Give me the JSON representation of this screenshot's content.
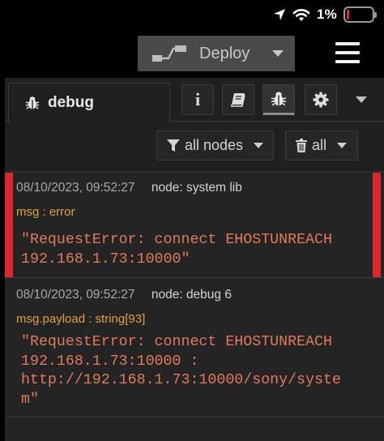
{
  "status": {
    "battery_percent": "1%",
    "battery_level": 0.1,
    "battery_color": "#e52b2b"
  },
  "header": {
    "deploy_label": "Deploy"
  },
  "sidebar": {
    "tab": {
      "label": "debug"
    },
    "toolbar_icons": [
      "info-icon",
      "book-icon",
      "bug-icon",
      "gear-icon"
    ],
    "filters": {
      "nodes_label": "all nodes",
      "clear_label": "all"
    }
  },
  "messages": [
    {
      "timestamp": "08/10/2023, 09:52:27",
      "node": "node: system lib",
      "topic": "msg : error",
      "payload": "\"RequestError: connect EHOSTUNREACH\n192.168.1.73:10000\"",
      "highlight_color": "#d9282f"
    },
    {
      "timestamp": "08/10/2023, 09:52:27",
      "node": "node: debug 6",
      "topic": "msg.payload : string[93]",
      "payload": "\"RequestError: connect EHOSTUNREACH\n192.168.1.73:10000 :\nhttp://192.168.1.73:10000/sony/syste\nm\""
    }
  ],
  "colors": {
    "payload_text": "#e07a5a",
    "topic_text": "#e0a040",
    "panel_bg": "#242424"
  }
}
